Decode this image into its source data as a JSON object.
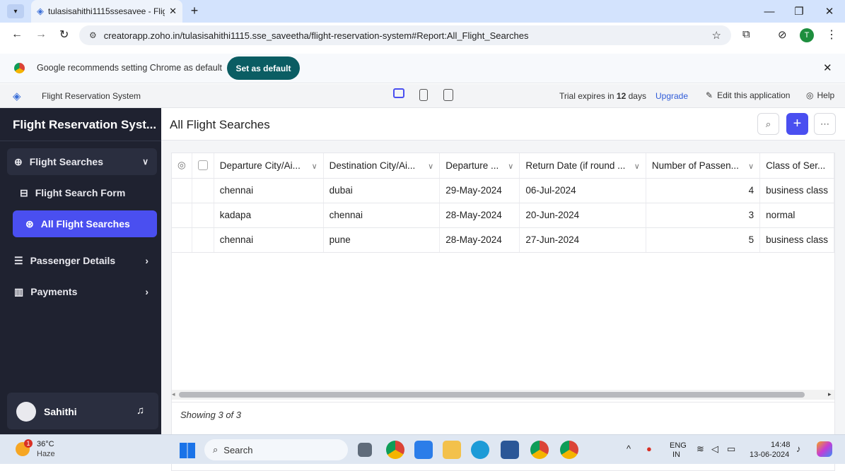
{
  "browser": {
    "tab_title": "tulasisahithi1115ssesavee - Fligh",
    "url": "creatorapp.zoho.in/tulasisahithi1115.sse_saveetha/flight-reservation-system#Report:All_Flight_Searches",
    "profile_initial": "T"
  },
  "notification": {
    "message": "Google recommends setting Chrome as default",
    "button": "Set as default"
  },
  "zoho_bar": {
    "app_name": "Flight Reservation System",
    "trial_prefix": "Trial expires in",
    "trial_days": "12",
    "trial_suffix": "days",
    "upgrade": "Upgrade",
    "edit": "Edit this application",
    "help": "Help"
  },
  "sidebar": {
    "title": "Flight Reservation Syst...",
    "items": [
      {
        "label": "Flight Searches",
        "icon": "search-circle-icon",
        "expanded": true
      },
      {
        "label": "Flight Search Form",
        "icon": "form-icon"
      },
      {
        "label": "All Flight Searches",
        "icon": "globe-icon",
        "active": true
      },
      {
        "label": "Passenger Details",
        "icon": "people-list-icon"
      },
      {
        "label": "Payments",
        "icon": "building-icon"
      }
    ],
    "user": "Sahithi"
  },
  "report": {
    "title": "All Flight Searches",
    "columns": [
      "Departure City/Ai...",
      "Destination City/Ai...",
      "Departure ...",
      "Return Date (if round ...",
      "Number of Passen...",
      "Class of Ser..."
    ],
    "rows": [
      [
        "chennai",
        "dubai",
        "29-May-2024",
        "06-Jul-2024",
        "4",
        "business class"
      ],
      [
        "kadapa",
        "chennai",
        "28-May-2024",
        "20-Jun-2024",
        "3",
        "normal"
      ],
      [
        "chennai",
        "pune",
        "28-May-2024",
        "27-Jun-2024",
        "5",
        "business class"
      ]
    ],
    "footer": "Showing 3 of 3"
  },
  "taskbar": {
    "weather_temp": "36°C",
    "weather_desc": "Haze",
    "weather_badge": "1",
    "search_placeholder": "Search",
    "lang_top": "ENG",
    "lang_bottom": "IN",
    "time": "14:48",
    "date": "13-06-2024"
  },
  "colors": {
    "sidebar_bg": "#1f2230",
    "active_item": "#4a4ff0",
    "set_default_btn": "#0b5d63",
    "add_button": "#4a4ff0",
    "upgrade_link": "#2f5bd8"
  }
}
